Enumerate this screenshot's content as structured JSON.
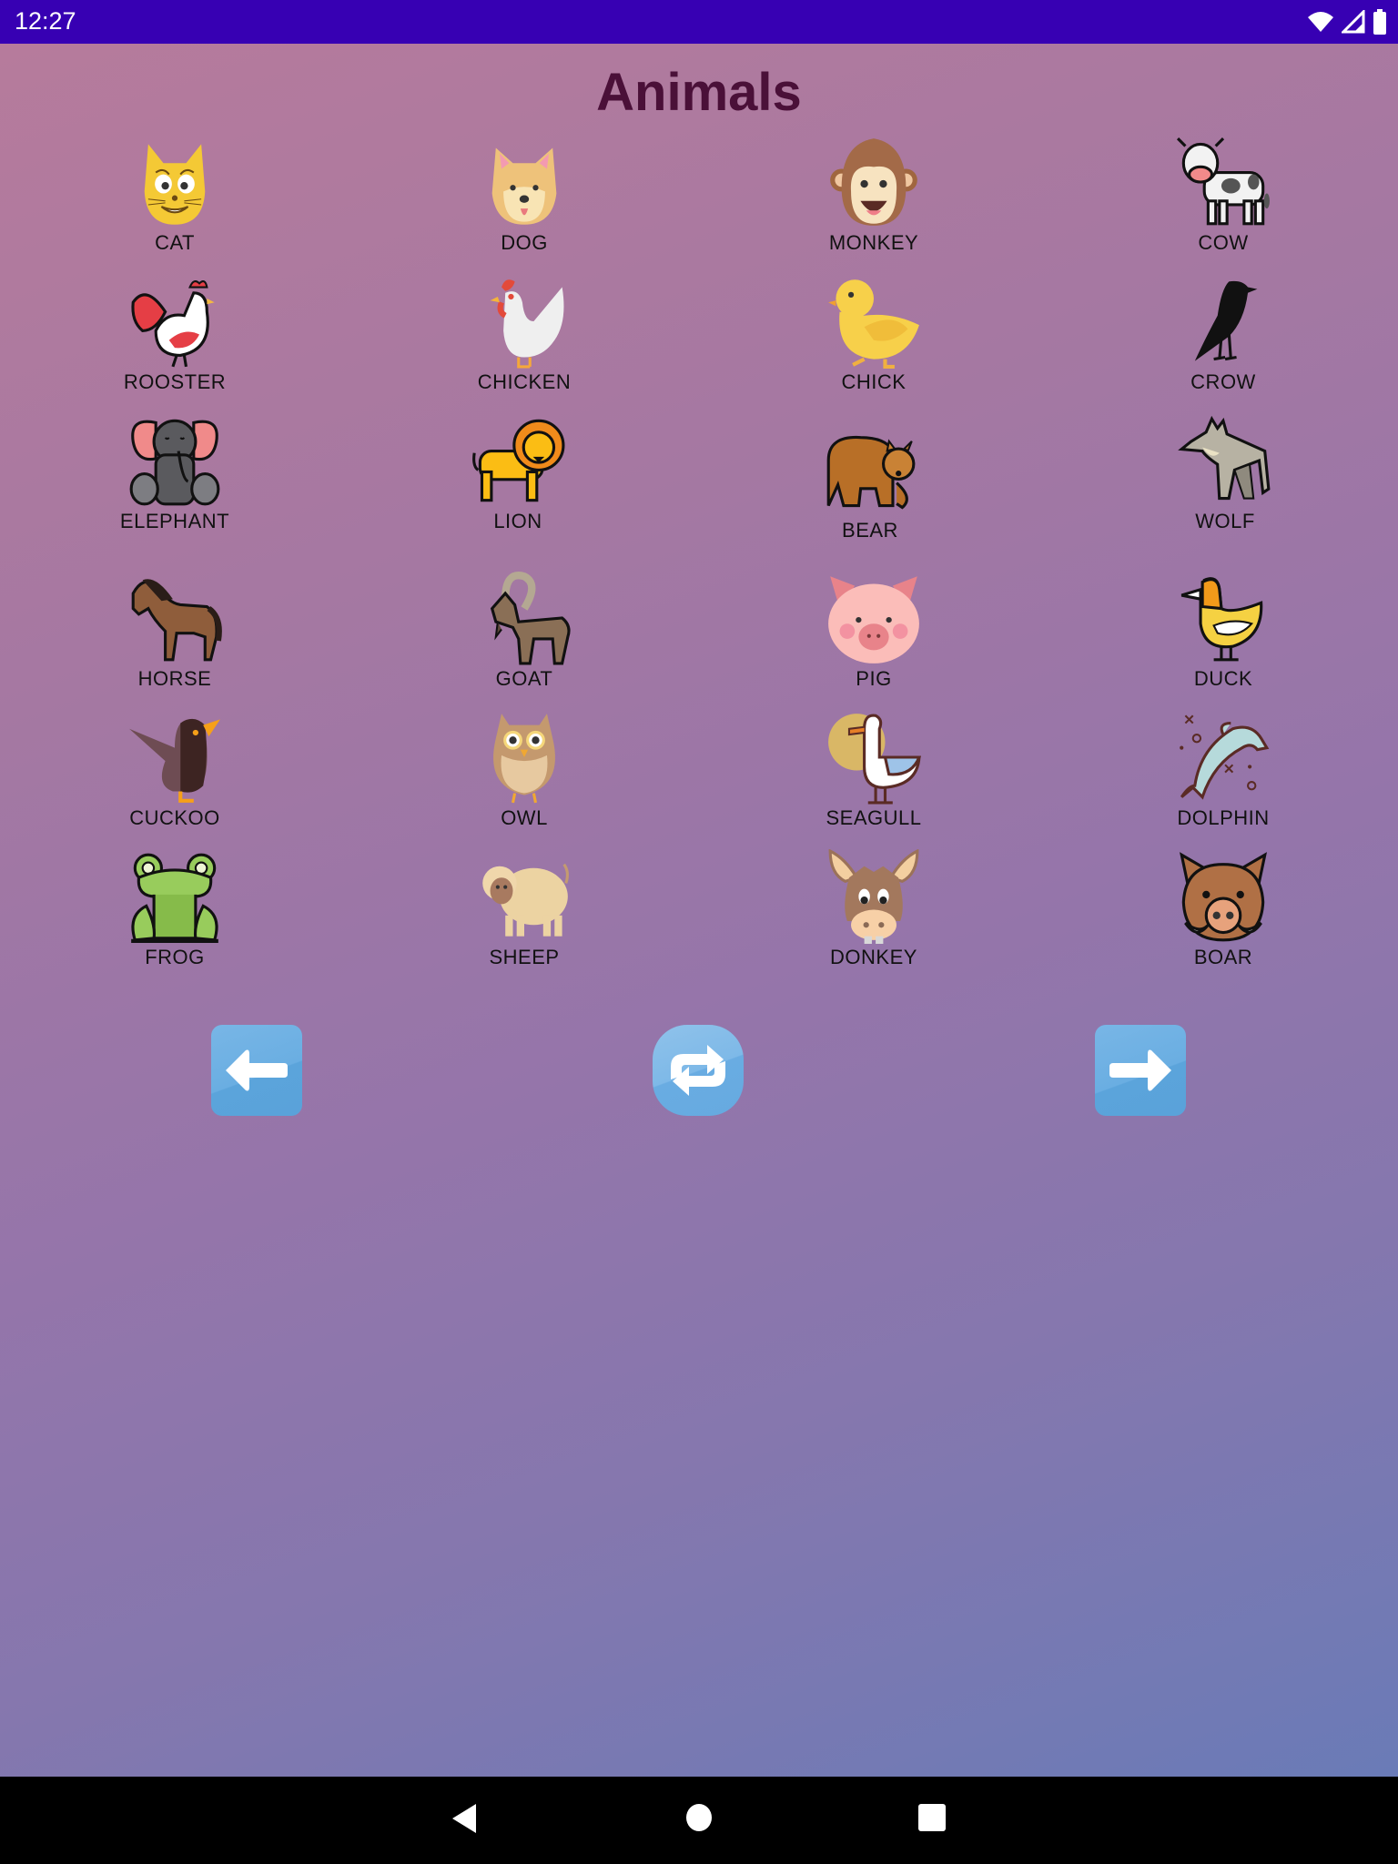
{
  "status_bar": {
    "time": "12:27",
    "icons": [
      "wifi-icon",
      "signal-icon",
      "battery-icon"
    ]
  },
  "page": {
    "title": "Animals"
  },
  "animals": [
    {
      "label": "CAT",
      "icon": "cat-icon"
    },
    {
      "label": "DOG",
      "icon": "dog-icon"
    },
    {
      "label": "MONKEY",
      "icon": "monkey-icon"
    },
    {
      "label": "COW",
      "icon": "cow-icon"
    },
    {
      "label": "ROOSTER",
      "icon": "rooster-icon"
    },
    {
      "label": "CHICKEN",
      "icon": "chicken-icon"
    },
    {
      "label": "CHICK",
      "icon": "chick-icon"
    },
    {
      "label": "CROW",
      "icon": "crow-icon"
    },
    {
      "label": "ELEPHANT",
      "icon": "elephant-icon"
    },
    {
      "label": "LION",
      "icon": "lion-icon"
    },
    {
      "label": "BEAR",
      "icon": "bear-icon"
    },
    {
      "label": "WOLF",
      "icon": "wolf-icon"
    },
    {
      "label": "HORSE",
      "icon": "horse-icon"
    },
    {
      "label": "GOAT",
      "icon": "goat-icon"
    },
    {
      "label": "PIG",
      "icon": "pig-icon"
    },
    {
      "label": "DUCK",
      "icon": "duck-icon"
    },
    {
      "label": "CUCKOO",
      "icon": "cuckoo-icon"
    },
    {
      "label": "OWL",
      "icon": "owl-icon"
    },
    {
      "label": "SEAGULL",
      "icon": "seagull-icon"
    },
    {
      "label": "DOLPHIN",
      "icon": "dolphin-icon"
    },
    {
      "label": "FROG",
      "icon": "frog-icon"
    },
    {
      "label": "SHEEP",
      "icon": "sheep-icon"
    },
    {
      "label": "DONKEY",
      "icon": "donkey-icon"
    },
    {
      "label": "BOAR",
      "icon": "boar-icon"
    }
  ],
  "controls": {
    "previous": {
      "icon": "arrow-left-icon"
    },
    "refresh": {
      "icon": "refresh-icon"
    },
    "next": {
      "icon": "arrow-right-icon"
    }
  },
  "system_nav": {
    "back": "back-icon",
    "home": "home-icon",
    "recents": "recents-icon"
  },
  "colors": {
    "status_bar": "#3700b3",
    "title": "#4a1038",
    "gradient_start": "#b67b9c",
    "gradient_end": "#6a7bb7",
    "button_blue": "#5aa2da"
  }
}
